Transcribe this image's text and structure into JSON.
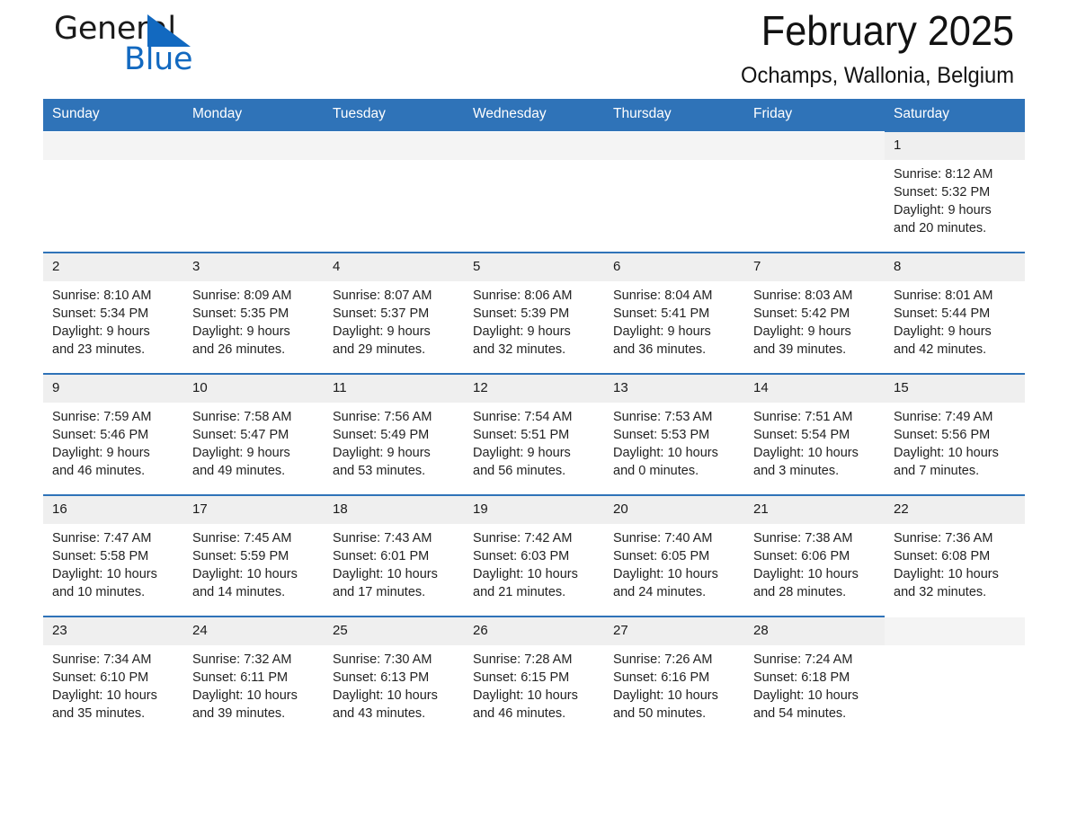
{
  "brand": {
    "name_part1": "General",
    "name_part2": "Blue",
    "triangle_color": "#1269c0",
    "icon": "blue-triangle-logo"
  },
  "header": {
    "title": "February 2025",
    "location": "Ochamps, Wallonia, Belgium"
  },
  "theme": {
    "header_blue": "#2f73b8",
    "row_border_blue": "#2f73b8",
    "daynum_band": "#efefef",
    "text": "#222222"
  },
  "weekdays": [
    "Sunday",
    "Monday",
    "Tuesday",
    "Wednesday",
    "Thursday",
    "Friday",
    "Saturday"
  ],
  "weeks": [
    [
      {
        "empty": true
      },
      {
        "empty": true
      },
      {
        "empty": true
      },
      {
        "empty": true
      },
      {
        "empty": true
      },
      {
        "empty": true
      },
      {
        "day": "1",
        "sunrise": "Sunrise: 8:12 AM",
        "sunset": "Sunset: 5:32 PM",
        "daylight1": "Daylight: 9 hours",
        "daylight2": "and 20 minutes."
      }
    ],
    [
      {
        "day": "2",
        "sunrise": "Sunrise: 8:10 AM",
        "sunset": "Sunset: 5:34 PM",
        "daylight1": "Daylight: 9 hours",
        "daylight2": "and 23 minutes."
      },
      {
        "day": "3",
        "sunrise": "Sunrise: 8:09 AM",
        "sunset": "Sunset: 5:35 PM",
        "daylight1": "Daylight: 9 hours",
        "daylight2": "and 26 minutes."
      },
      {
        "day": "4",
        "sunrise": "Sunrise: 8:07 AM",
        "sunset": "Sunset: 5:37 PM",
        "daylight1": "Daylight: 9 hours",
        "daylight2": "and 29 minutes."
      },
      {
        "day": "5",
        "sunrise": "Sunrise: 8:06 AM",
        "sunset": "Sunset: 5:39 PM",
        "daylight1": "Daylight: 9 hours",
        "daylight2": "and 32 minutes."
      },
      {
        "day": "6",
        "sunrise": "Sunrise: 8:04 AM",
        "sunset": "Sunset: 5:41 PM",
        "daylight1": "Daylight: 9 hours",
        "daylight2": "and 36 minutes."
      },
      {
        "day": "7",
        "sunrise": "Sunrise: 8:03 AM",
        "sunset": "Sunset: 5:42 PM",
        "daylight1": "Daylight: 9 hours",
        "daylight2": "and 39 minutes."
      },
      {
        "day": "8",
        "sunrise": "Sunrise: 8:01 AM",
        "sunset": "Sunset: 5:44 PM",
        "daylight1": "Daylight: 9 hours",
        "daylight2": "and 42 minutes."
      }
    ],
    [
      {
        "day": "9",
        "sunrise": "Sunrise: 7:59 AM",
        "sunset": "Sunset: 5:46 PM",
        "daylight1": "Daylight: 9 hours",
        "daylight2": "and 46 minutes."
      },
      {
        "day": "10",
        "sunrise": "Sunrise: 7:58 AM",
        "sunset": "Sunset: 5:47 PM",
        "daylight1": "Daylight: 9 hours",
        "daylight2": "and 49 minutes."
      },
      {
        "day": "11",
        "sunrise": "Sunrise: 7:56 AM",
        "sunset": "Sunset: 5:49 PM",
        "daylight1": "Daylight: 9 hours",
        "daylight2": "and 53 minutes."
      },
      {
        "day": "12",
        "sunrise": "Sunrise: 7:54 AM",
        "sunset": "Sunset: 5:51 PM",
        "daylight1": "Daylight: 9 hours",
        "daylight2": "and 56 minutes."
      },
      {
        "day": "13",
        "sunrise": "Sunrise: 7:53 AM",
        "sunset": "Sunset: 5:53 PM",
        "daylight1": "Daylight: 10 hours",
        "daylight2": "and 0 minutes."
      },
      {
        "day": "14",
        "sunrise": "Sunrise: 7:51 AM",
        "sunset": "Sunset: 5:54 PM",
        "daylight1": "Daylight: 10 hours",
        "daylight2": "and 3 minutes."
      },
      {
        "day": "15",
        "sunrise": "Sunrise: 7:49 AM",
        "sunset": "Sunset: 5:56 PM",
        "daylight1": "Daylight: 10 hours",
        "daylight2": "and 7 minutes."
      }
    ],
    [
      {
        "day": "16",
        "sunrise": "Sunrise: 7:47 AM",
        "sunset": "Sunset: 5:58 PM",
        "daylight1": "Daylight: 10 hours",
        "daylight2": "and 10 minutes."
      },
      {
        "day": "17",
        "sunrise": "Sunrise: 7:45 AM",
        "sunset": "Sunset: 5:59 PM",
        "daylight1": "Daylight: 10 hours",
        "daylight2": "and 14 minutes."
      },
      {
        "day": "18",
        "sunrise": "Sunrise: 7:43 AM",
        "sunset": "Sunset: 6:01 PM",
        "daylight1": "Daylight: 10 hours",
        "daylight2": "and 17 minutes."
      },
      {
        "day": "19",
        "sunrise": "Sunrise: 7:42 AM",
        "sunset": "Sunset: 6:03 PM",
        "daylight1": "Daylight: 10 hours",
        "daylight2": "and 21 minutes."
      },
      {
        "day": "20",
        "sunrise": "Sunrise: 7:40 AM",
        "sunset": "Sunset: 6:05 PM",
        "daylight1": "Daylight: 10 hours",
        "daylight2": "and 24 minutes."
      },
      {
        "day": "21",
        "sunrise": "Sunrise: 7:38 AM",
        "sunset": "Sunset: 6:06 PM",
        "daylight1": "Daylight: 10 hours",
        "daylight2": "and 28 minutes."
      },
      {
        "day": "22",
        "sunrise": "Sunrise: 7:36 AM",
        "sunset": "Sunset: 6:08 PM",
        "daylight1": "Daylight: 10 hours",
        "daylight2": "and 32 minutes."
      }
    ],
    [
      {
        "day": "23",
        "sunrise": "Sunrise: 7:34 AM",
        "sunset": "Sunset: 6:10 PM",
        "daylight1": "Daylight: 10 hours",
        "daylight2": "and 35 minutes."
      },
      {
        "day": "24",
        "sunrise": "Sunrise: 7:32 AM",
        "sunset": "Sunset: 6:11 PM",
        "daylight1": "Daylight: 10 hours",
        "daylight2": "and 39 minutes."
      },
      {
        "day": "25",
        "sunrise": "Sunrise: 7:30 AM",
        "sunset": "Sunset: 6:13 PM",
        "daylight1": "Daylight: 10 hours",
        "daylight2": "and 43 minutes."
      },
      {
        "day": "26",
        "sunrise": "Sunrise: 7:28 AM",
        "sunset": "Sunset: 6:15 PM",
        "daylight1": "Daylight: 10 hours",
        "daylight2": "and 46 minutes."
      },
      {
        "day": "27",
        "sunrise": "Sunrise: 7:26 AM",
        "sunset": "Sunset: 6:16 PM",
        "daylight1": "Daylight: 10 hours",
        "daylight2": "and 50 minutes."
      },
      {
        "day": "28",
        "sunrise": "Sunrise: 7:24 AM",
        "sunset": "Sunset: 6:18 PM",
        "daylight1": "Daylight: 10 hours",
        "daylight2": "and 54 minutes."
      },
      {
        "empty": true
      }
    ]
  ]
}
